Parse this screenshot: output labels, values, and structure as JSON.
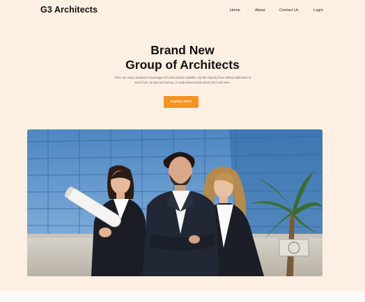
{
  "brand": {
    "name": "G3 Architects"
  },
  "nav": {
    "items": [
      {
        "label": "Home"
      },
      {
        "label": "About"
      },
      {
        "label": "Contact Us"
      },
      {
        "label": "Login"
      }
    ]
  },
  "hero": {
    "title_line1": "Brand New",
    "title_line2": "Group of Architects",
    "description_line1": "There are many variations of passages of Lorem Ipsum available, but the majority have suffered alteration in",
    "description_line2": "some form, by injected humour, or randomised words which don't look even.",
    "cta_label": "Explore More"
  },
  "image": {
    "subject": "team-photo",
    "colors": {
      "sky": "#6fa3d6",
      "glass": "#3e78b4",
      "suit": "#1c2230",
      "accent": "#f5931e"
    }
  }
}
